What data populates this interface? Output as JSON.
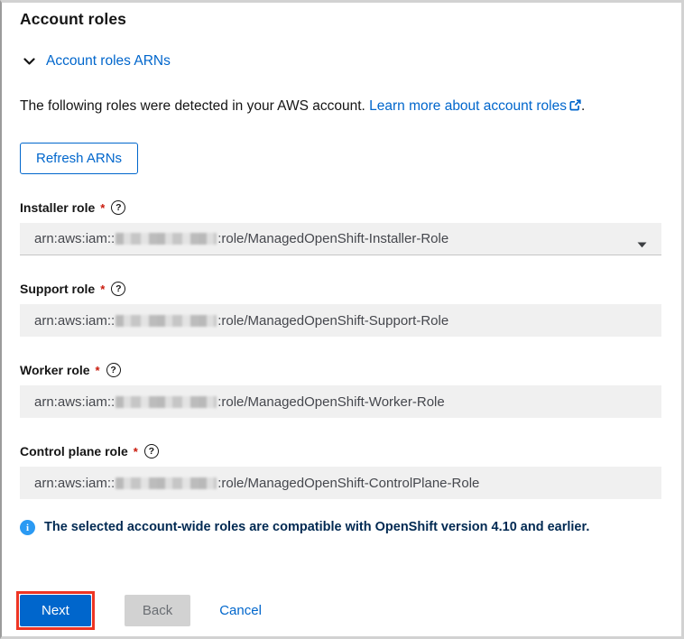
{
  "page": {
    "title": "Account roles"
  },
  "expandable": {
    "label": "Account roles ARNs"
  },
  "intro": {
    "text_before": "The following roles were detected in your AWS account. ",
    "link_text": "Learn more about account roles",
    "suffix": "."
  },
  "toolbar": {
    "refresh_label": "Refresh ARNs"
  },
  "fields": [
    {
      "label": "Installer role",
      "required": "*",
      "arn_prefix": "arn:aws:iam::",
      "arn_suffix": ":role/ManagedOpenShift-Installer-Role",
      "type": "dropdown"
    },
    {
      "label": "Support role",
      "required": "*",
      "arn_prefix": "arn:aws:iam::",
      "arn_suffix": ":role/ManagedOpenShift-Support-Role",
      "type": "readonly"
    },
    {
      "label": "Worker role",
      "required": "*",
      "arn_prefix": "arn:aws:iam::",
      "arn_suffix": ":role/ManagedOpenShift-Worker-Role",
      "type": "readonly"
    },
    {
      "label": "Control plane role",
      "required": "*",
      "arn_prefix": "arn:aws:iam::",
      "arn_suffix": ":role/ManagedOpenShift-ControlPlane-Role",
      "type": "readonly"
    }
  ],
  "info": {
    "text": "The selected account-wide roles are compatible with OpenShift version 4.10 and earlier."
  },
  "footer": {
    "next_label": "Next",
    "back_label": "Back",
    "cancel_label": "Cancel"
  },
  "icons": {
    "chevron": "chevron-down-icon",
    "external": "external-link-icon",
    "help": "help-icon",
    "info": "info-icon",
    "caret": "caret-down-icon"
  },
  "colors": {
    "accent": "#0066cc",
    "text": "#151515",
    "field-bg": "#f0f0f0",
    "field-text": "#45474d",
    "disabled-bg": "#d2d2d2",
    "disabled-text": "#6a6e73",
    "info-icon": "#2b9af3",
    "info-text": "#002952",
    "required": "#c9190b",
    "highlight": "#ee3524",
    "frame": "#d2d2d2"
  }
}
